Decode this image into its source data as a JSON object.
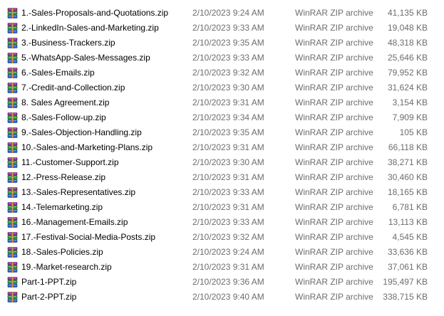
{
  "files": [
    {
      "name": "1.-Sales-Proposals-and-Quotations.zip",
      "date": "2/10/2023 9:24 AM",
      "type": "WinRAR ZIP archive",
      "size": "41,135 KB"
    },
    {
      "name": "2.-LinkedIn-Sales-and-Marketing.zip",
      "date": "2/10/2023 9:33 AM",
      "type": "WinRAR ZIP archive",
      "size": "19,048 KB"
    },
    {
      "name": "3.-Business-Trackers.zip",
      "date": "2/10/2023 9:35 AM",
      "type": "WinRAR ZIP archive",
      "size": "48,318 KB"
    },
    {
      "name": "5.-WhatsApp-Sales-Messages.zip",
      "date": "2/10/2023 9:33 AM",
      "type": "WinRAR ZIP archive",
      "size": "25,646 KB"
    },
    {
      "name": "6.-Sales-Emails.zip",
      "date": "2/10/2023 9:32 AM",
      "type": "WinRAR ZIP archive",
      "size": "79,952 KB"
    },
    {
      "name": "7.-Credit-and-Collection.zip",
      "date": "2/10/2023 9:30 AM",
      "type": "WinRAR ZIP archive",
      "size": "31,624 KB"
    },
    {
      "name": "8. Sales Agreement.zip",
      "date": "2/10/2023 9:31 AM",
      "type": "WinRAR ZIP archive",
      "size": "3,154 KB"
    },
    {
      "name": "8.-Sales-Follow-up.zip",
      "date": "2/10/2023 9:34 AM",
      "type": "WinRAR ZIP archive",
      "size": "7,909 KB"
    },
    {
      "name": "9.-Sales-Objection-Handling.zip",
      "date": "2/10/2023 9:35 AM",
      "type": "WinRAR ZIP archive",
      "size": "105 KB"
    },
    {
      "name": "10.-Sales-and-Marketing-Plans.zip",
      "date": "2/10/2023 9:31 AM",
      "type": "WinRAR ZIP archive",
      "size": "66,118 KB"
    },
    {
      "name": "11.-Customer-Support.zip",
      "date": "2/10/2023 9:30 AM",
      "type": "WinRAR ZIP archive",
      "size": "38,271 KB"
    },
    {
      "name": "12.-Press-Release.zip",
      "date": "2/10/2023 9:31 AM",
      "type": "WinRAR ZIP archive",
      "size": "30,460 KB"
    },
    {
      "name": "13.-Sales-Representatives.zip",
      "date": "2/10/2023 9:33 AM",
      "type": "WinRAR ZIP archive",
      "size": "18,165 KB"
    },
    {
      "name": "14.-Telemarketing.zip",
      "date": "2/10/2023 9:31 AM",
      "type": "WinRAR ZIP archive",
      "size": "6,781 KB"
    },
    {
      "name": "16.-Management-Emails.zip",
      "date": "2/10/2023 9:33 AM",
      "type": "WinRAR ZIP archive",
      "size": "13,113 KB"
    },
    {
      "name": "17.-Festival-Social-Media-Posts.zip",
      "date": "2/10/2023 9:32 AM",
      "type": "WinRAR ZIP archive",
      "size": "4,545 KB"
    },
    {
      "name": "18.-Sales-Policies.zip",
      "date": "2/10/2023 9:24 AM",
      "type": "WinRAR ZIP archive",
      "size": "33,636 KB"
    },
    {
      "name": "19.-Market-research.zip",
      "date": "2/10/2023 9:31 AM",
      "type": "WinRAR ZIP archive",
      "size": "37,061 KB"
    },
    {
      "name": "Part-1-PPT.zip",
      "date": "2/10/2023 9:36 AM",
      "type": "WinRAR ZIP archive",
      "size": "195,497 KB"
    },
    {
      "name": "Part-2-PPT.zip",
      "date": "2/10/2023 9:40 AM",
      "type": "WinRAR ZIP archive",
      "size": "338,715 KB"
    }
  ],
  "icon": "winrar-archive-icon",
  "colors": {
    "text": "#000000",
    "secondary_text": "#6d6d6d",
    "background": "#ffffff",
    "hover": "#e5f3ff"
  }
}
